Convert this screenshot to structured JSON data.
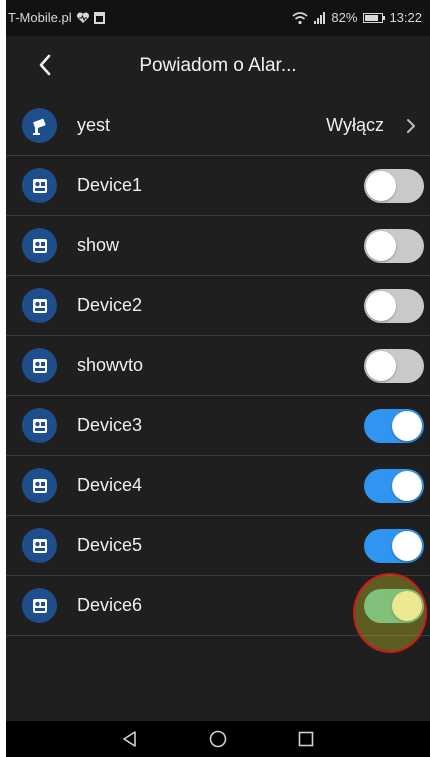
{
  "status_bar": {
    "carrier": "T-Mobile.pl",
    "battery": "82%",
    "battery_level": 0.82,
    "time": "13:22"
  },
  "header": {
    "title": "Powiadom o Alar..."
  },
  "devices": [
    {
      "label": "yest",
      "icon": "camera-icon",
      "value": "Wyłącz"
    },
    {
      "label": "Device1",
      "icon": "intercom-icon",
      "enabled": false
    },
    {
      "label": "show",
      "icon": "intercom-icon",
      "enabled": false
    },
    {
      "label": "Device2",
      "icon": "intercom-icon",
      "enabled": false
    },
    {
      "label": "showvto",
      "icon": "intercom-icon",
      "enabled": false
    },
    {
      "label": "Device3",
      "icon": "intercom-icon",
      "enabled": true
    },
    {
      "label": "Device4",
      "icon": "intercom-icon",
      "enabled": true
    },
    {
      "label": "Device5",
      "icon": "intercom-icon",
      "enabled": true
    },
    {
      "label": "Device6",
      "icon": "intercom-icon",
      "enabled": true
    }
  ],
  "colors": {
    "background": "#1f1f1f",
    "icon_circle": "#1e4f8c",
    "toggle_on": "#2f95f0",
    "toggle_off": "#c9c9c9",
    "tap_highlight": "#cc1a1a"
  }
}
